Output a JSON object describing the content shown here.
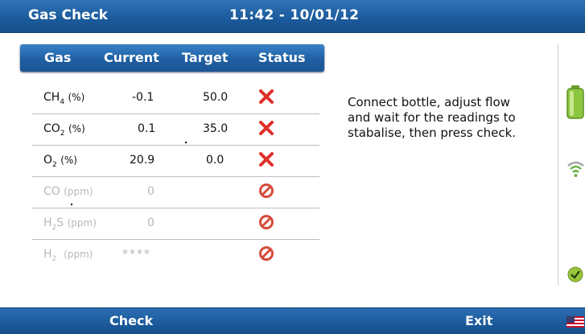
{
  "titlebar": {
    "title": "Gas Check",
    "clock": "11:42 - 10/01/12"
  },
  "table": {
    "headers": {
      "gas": "Gas",
      "current": "Current",
      "target": "Target",
      "status": "Status"
    },
    "rows": [
      {
        "gas": "CH",
        "sub": "4",
        "unit": "(%)",
        "current": "-0.1",
        "target": "50.0",
        "status": "fail"
      },
      {
        "gas": "CO",
        "sub": "2",
        "unit": "(%)",
        "current": "0.1",
        "target": "35.0",
        "status": "fail"
      },
      {
        "gas": "O",
        "sub": "2",
        "unit": "(%)",
        "current": "20.9",
        "target": "0.0",
        "status": "fail"
      },
      {
        "gas": "CO",
        "sub": "",
        "unit": "(ppm)",
        "current": "0",
        "target": "",
        "status": "disabled"
      },
      {
        "gas": "H",
        "sub": "2",
        "gas_suffix": "S",
        "unit": "(ppm)",
        "current": "0",
        "target": "",
        "status": "disabled"
      },
      {
        "gas": "H",
        "sub": "2",
        "unit": "(ppm)",
        "current": "****",
        "target": "",
        "status": "disabled"
      }
    ]
  },
  "instruction": "Connect bottle, adjust flow and wait for the readings to stabalise, then press check.",
  "icons": {
    "fail": "cross-icon",
    "disabled": "no-entry-icon",
    "battery": "battery-icon",
    "signal": "signal-icon",
    "ok": "check-ok-icon",
    "flag": "us-flag-icon"
  },
  "colors": {
    "accent": "#1b5a9b",
    "fail": "#e0302a",
    "disabled": "#d64a3a",
    "battery": "#8cc63f"
  },
  "footer": {
    "left_button": "Check",
    "right_button": "Exit"
  }
}
